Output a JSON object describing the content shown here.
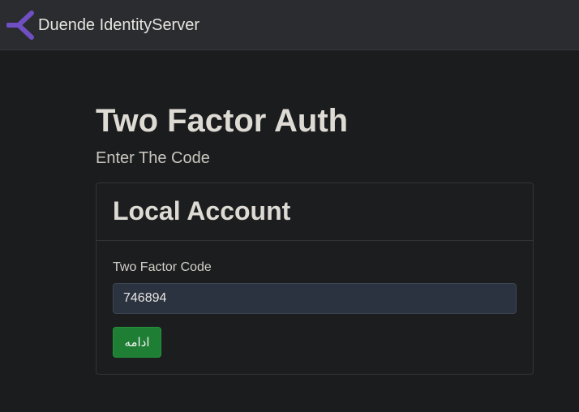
{
  "navbar": {
    "brand": "Duende IdentityServer",
    "logo_icon": "duende-logo-icon",
    "logo_color": "#6f4fc2"
  },
  "page": {
    "title": "Two Factor Auth",
    "subtitle": "Enter The Code"
  },
  "card": {
    "title": "Local Account",
    "field_label": "Two Factor Code",
    "code_value": "746894",
    "submit_label": "ادامه",
    "submit_color": "#1e7e34"
  }
}
